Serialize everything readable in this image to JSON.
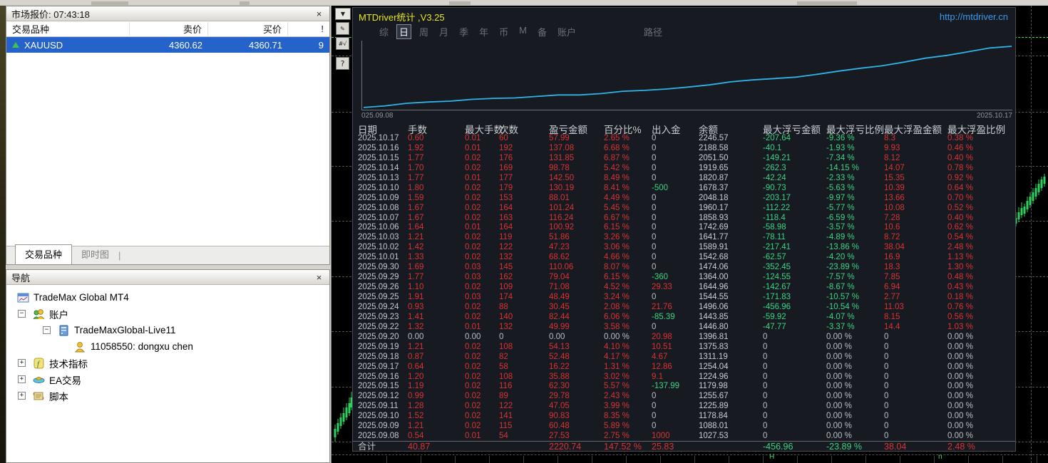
{
  "market_watch": {
    "title": "市场报价: 07:43:18",
    "close_glyph": "×",
    "columns": [
      "交易品种",
      "卖价",
      "买价",
      "!"
    ],
    "symbol": {
      "name": "XAUUSD",
      "bid": "4360.62",
      "ask": "4360.71",
      "spread": "9",
      "direction": "up"
    },
    "tabs": [
      {
        "label": "交易品种",
        "active": true
      },
      {
        "label": "即时图",
        "active": false
      }
    ]
  },
  "navigator": {
    "title": "导航",
    "close_glyph": "×",
    "tree": [
      {
        "label": "TradeMax Global MT4",
        "icon": "mt4-logo-icon",
        "indent": 0,
        "expand": ""
      },
      {
        "label": "账户",
        "icon": "accounts-icon",
        "indent": 1,
        "expand": "minus"
      },
      {
        "label": "TradeMaxGlobal-Live11",
        "icon": "server-icon",
        "indent": 2,
        "expand": "minus"
      },
      {
        "label": "11058550: dongxu chen",
        "icon": "user-icon",
        "indent": 3,
        "expand": ""
      },
      {
        "label": "技术指标",
        "icon": "indicators-icon",
        "indent": 1,
        "expand": "plus"
      },
      {
        "label": "EA交易",
        "icon": "ea-icon",
        "indent": 1,
        "expand": "plus"
      },
      {
        "label": "脚本",
        "icon": "scripts-icon",
        "indent": 1,
        "expand": "plus"
      }
    ]
  },
  "stats_panel": {
    "title": "MTDriver统计 ,V3.25",
    "link": "http://mtdriver.cn",
    "toolbar": {
      "buttons": [
        "综",
        "日",
        "周",
        "月",
        "季",
        "年",
        "币",
        "M",
        "备",
        "账户"
      ],
      "selected_index": 1,
      "path_button": "路径"
    },
    "chart": {
      "left_label": "025.09.08",
      "right_label": "2025.10.17",
      "line_color": "#2fb4e8"
    },
    "table": {
      "headers": [
        "日期",
        "手数",
        "最大手数",
        "次数",
        "盈亏金额",
        "百分比%",
        "出入金",
        "余额",
        "最大浮亏金额",
        "最大浮亏比例",
        "最大浮盈金额",
        "最大浮盈比例"
      ],
      "rows": [
        [
          "2025.10.17",
          "0.60",
          "0.01",
          "60",
          "57.99",
          "2.65 %",
          "0",
          "2246.57",
          "-207.64",
          "-9.36 %",
          "8.3",
          "0.38 %"
        ],
        [
          "2025.10.16",
          "1.92",
          "0.01",
          "192",
          "137.08",
          "6.68 %",
          "0",
          "2188.58",
          "-40.1",
          "-1.93 %",
          "9.93",
          "0.46 %"
        ],
        [
          "2025.10.15",
          "1.77",
          "0.02",
          "176",
          "131.85",
          "6.87 %",
          "0",
          "2051.50",
          "-149.21",
          "-7.34 %",
          "8.12",
          "0.40 %"
        ],
        [
          "2025.10.14",
          "1.70",
          "0.02",
          "169",
          "98.78",
          "5.42 %",
          "0",
          "1919.65",
          "-262.3",
          "-14.15 %",
          "14.07",
          "0.78 %"
        ],
        [
          "2025.10.13",
          "1.77",
          "0.01",
          "177",
          "142.50",
          "8.49 %",
          "0",
          "1820.87",
          "-42.24",
          "-2.33 %",
          "15.35",
          "0.92 %"
        ],
        [
          "2025.10.10",
          "1.80",
          "0.02",
          "179",
          "130.19",
          "8.41 %",
          "-500",
          "1678.37",
          "-90.73",
          "-5.63 %",
          "10.39",
          "0.64 %"
        ],
        [
          "2025.10.09",
          "1.59",
          "0.02",
          "153",
          "88.01",
          "4.49 %",
          "0",
          "2048.18",
          "-203.17",
          "-9.97 %",
          "13.66",
          "0.70 %"
        ],
        [
          "2025.10.08",
          "1.67",
          "0.02",
          "164",
          "101.24",
          "5.45 %",
          "0",
          "1960.17",
          "-112.22",
          "-5.77 %",
          "10.08",
          "0.52 %"
        ],
        [
          "2025.10.07",
          "1.67",
          "0.02",
          "163",
          "116.24",
          "6.67 %",
          "0",
          "1858.93",
          "-118.4",
          "-6.59 %",
          "7.28",
          "0.40 %"
        ],
        [
          "2025.10.06",
          "1.64",
          "0.01",
          "164",
          "100.92",
          "6.15 %",
          "0",
          "1742.69",
          "-58.98",
          "-3.57 %",
          "10.6",
          "0.62 %"
        ],
        [
          "2025.10.03",
          "1.21",
          "0.02",
          "119",
          "51.86",
          "3.26 %",
          "0",
          "1641.77",
          "-78.11",
          "-4.89 %",
          "8.72",
          "0.54 %"
        ],
        [
          "2025.10.02",
          "1.42",
          "0.02",
          "122",
          "47.23",
          "3.06 %",
          "0",
          "1589.91",
          "-217.41",
          "-13.86 %",
          "38.04",
          "2.48 %"
        ],
        [
          "2025.10.01",
          "1.33",
          "0.02",
          "132",
          "68.62",
          "4.66 %",
          "0",
          "1542.68",
          "-62.57",
          "-4.20 %",
          "16.9",
          "1.13 %"
        ],
        [
          "2025.09.30",
          "1.69",
          "0.03",
          "145",
          "110.06",
          "8.07 %",
          "0",
          "1474.06",
          "-352.45",
          "-23.89 %",
          "18.3",
          "1.30 %"
        ],
        [
          "2025.09.29",
          "1.77",
          "0.03",
          "162",
          "79.04",
          "6.15 %",
          "-360",
          "1364.00",
          "-124.55",
          "-7.57 %",
          "7.85",
          "0.48 %"
        ],
        [
          "2025.09.26",
          "1.10",
          "0.02",
          "109",
          "71.08",
          "4.52 %",
          "29.33",
          "1644.96",
          "-142.67",
          "-8.67 %",
          "6.94",
          "0.43 %"
        ],
        [
          "2025.09.25",
          "1.91",
          "0.03",
          "174",
          "48.49",
          "3.24 %",
          "0",
          "1544.55",
          "-171.83",
          "-10.57 %",
          "2.77",
          "0.18 %"
        ],
        [
          "2025.09.24",
          "0.93",
          "0.02",
          "88",
          "30.45",
          "2.08 %",
          "21.76",
          "1496.06",
          "-456.96",
          "-10.54 %",
          "11.03",
          "0.76 %"
        ],
        [
          "2025.09.23",
          "1.41",
          "0.02",
          "140",
          "82.44",
          "6.06 %",
          "-85.39",
          "1443.85",
          "-59.92",
          "-4.07 %",
          "8.15",
          "0.56 %"
        ],
        [
          "2025.09.22",
          "1.32",
          "0.01",
          "132",
          "49.99",
          "3.58 %",
          "0",
          "1446.80",
          "-47.77",
          "-3.37 %",
          "14.4",
          "1.03 %"
        ],
        [
          "2025.09.20",
          "0.00",
          "0.00",
          "0",
          "0.00",
          "0.00 %",
          "20.98",
          "1396.81",
          "0",
          "0.00 %",
          "0",
          "0.00 %"
        ],
        [
          "2025.09.19",
          "1.21",
          "0.02",
          "108",
          "54.13",
          "4.10 %",
          "10.51",
          "1375.83",
          "0",
          "0.00 %",
          "0",
          "0.00 %"
        ],
        [
          "2025.09.18",
          "0.87",
          "0.02",
          "82",
          "52.48",
          "4.17 %",
          "4.67",
          "1311.19",
          "0",
          "0.00 %",
          "0",
          "0.00 %"
        ],
        [
          "2025.09.17",
          "0.64",
          "0.02",
          "58",
          "16.22",
          "1.31 %",
          "12.86",
          "1254.04",
          "0",
          "0.00 %",
          "0",
          "0.00 %"
        ],
        [
          "2025.09.16",
          "1.20",
          "0.02",
          "108",
          "35.88",
          "3.02 %",
          "9.1",
          "1224.96",
          "0",
          "0.00 %",
          "0",
          "0.00 %"
        ],
        [
          "2025.09.15",
          "1.19",
          "0.02",
          "116",
          "62.30",
          "5.57 %",
          "-137.99",
          "1179.98",
          "0",
          "0.00 %",
          "0",
          "0.00 %"
        ],
        [
          "2025.09.12",
          "0.99",
          "0.02",
          "89",
          "29.78",
          "2.43 %",
          "0",
          "1255.67",
          "0",
          "0.00 %",
          "0",
          "0.00 %"
        ],
        [
          "2025.09.11",
          "1.28",
          "0.02",
          "122",
          "47.05",
          "3.99 %",
          "0",
          "1225.89",
          "0",
          "0.00 %",
          "0",
          "0.00 %"
        ],
        [
          "2025.09.10",
          "1.52",
          "0.02",
          "141",
          "90.83",
          "8.35 %",
          "0",
          "1178.84",
          "0",
          "0.00 %",
          "0",
          "0.00 %"
        ],
        [
          "2025.09.09",
          "1.21",
          "0.02",
          "115",
          "60.48",
          "5.89 %",
          "0",
          "1088.01",
          "0",
          "0.00 %",
          "0",
          "0.00 %"
        ],
        [
          "2025.09.08",
          "0.54",
          "0.01",
          "54",
          "27.53",
          "2.75 %",
          "1000",
          "1027.53",
          "0",
          "0.00 %",
          "0",
          "0.00 %"
        ]
      ],
      "total": [
        "合计",
        "40.87",
        "",
        "",
        "2220.74",
        "147.52 %",
        "25.83",
        "",
        "-456.96",
        "-23.89 %",
        "38.04",
        "2.48 %"
      ]
    }
  },
  "chart_window": {
    "side_buttons": [
      {
        "name": "panel-collapse-button",
        "glyph": "▼"
      },
      {
        "name": "draw-tool-button",
        "glyph": "✎"
      },
      {
        "name": "hash-check-button",
        "glyph": "#√"
      },
      {
        "name": "help-button",
        "glyph": "?"
      }
    ],
    "bottom_markers": [
      "H",
      "n"
    ]
  },
  "colors": {
    "profit_red": "#d83434",
    "loss_green": "#3ad584",
    "equity_curve_blue": "#2fb4e8",
    "selection_blue": "#2563cb",
    "title_yellow": "#e6e621",
    "link_blue": "#3b9af0"
  }
}
